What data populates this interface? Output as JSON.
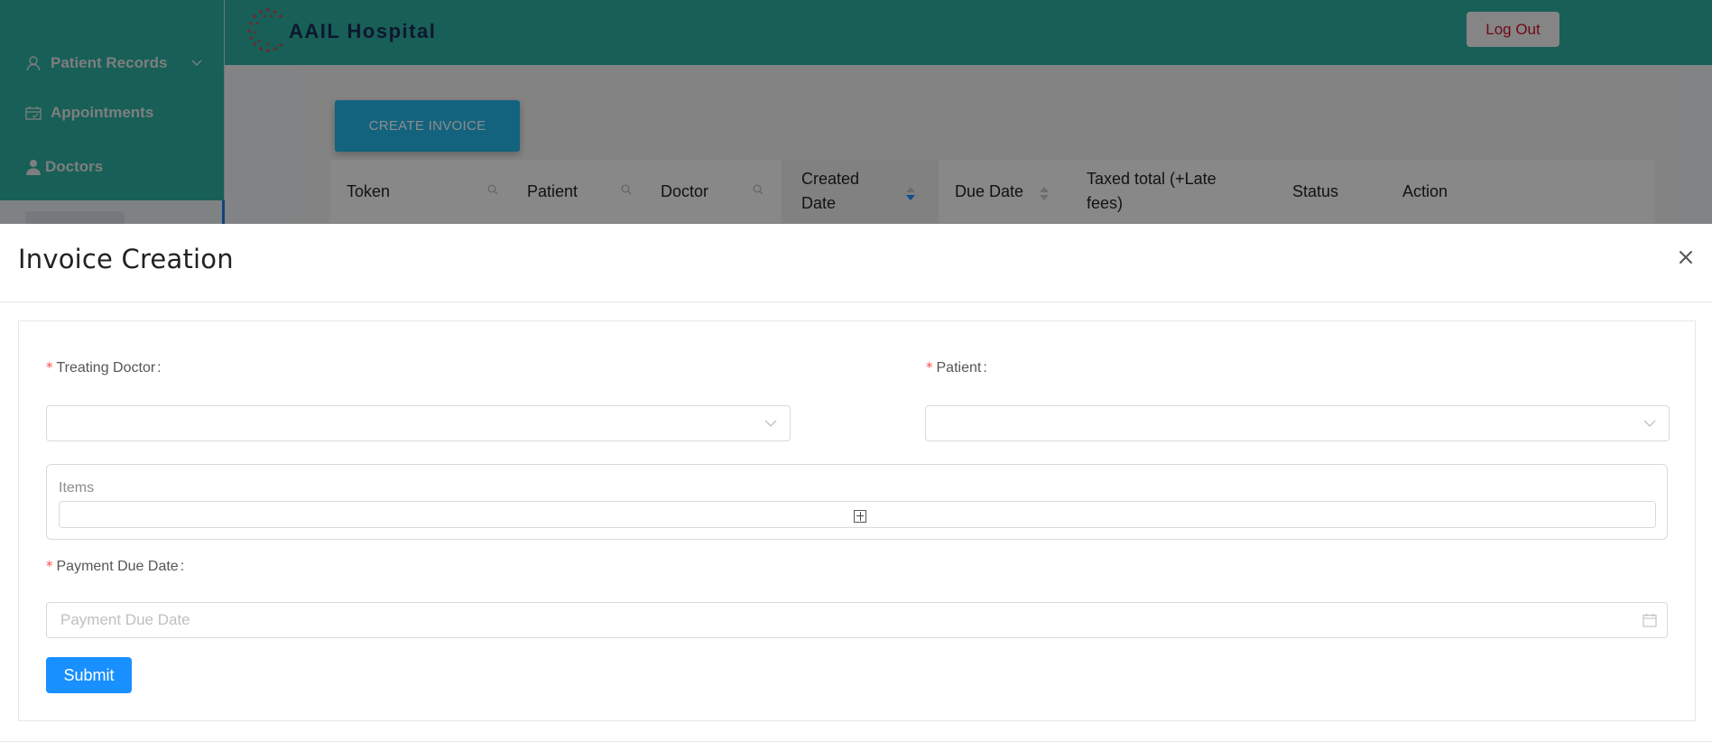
{
  "app": {
    "brand": "AAIL Hospital",
    "logout_label": "Log Out"
  },
  "sidebar": {
    "items": [
      {
        "label": "Patient Records",
        "icon": "user-icon",
        "has_submenu": true
      },
      {
        "label": "Appointments",
        "icon": "calendar-check-icon"
      },
      {
        "label": "Doctors",
        "icon": "doctor-icon"
      }
    ],
    "selected_item_obscured": true
  },
  "main": {
    "create_button_label": "CREATE INVOICE",
    "table": {
      "columns": [
        {
          "label": "Token",
          "filter": "search-icon"
        },
        {
          "label": "Patient",
          "filter": "search-icon"
        },
        {
          "label": "Doctor",
          "filter": "search-icon"
        },
        {
          "label": "Created Date",
          "sortable": true,
          "sort": "descending"
        },
        {
          "label": "Due Date",
          "sortable": true,
          "sort": "none"
        },
        {
          "label": "Taxed total (+Late fees)"
        },
        {
          "label": "Status"
        },
        {
          "label": "Action"
        }
      ]
    }
  },
  "modal": {
    "title": "Invoice Creation",
    "close_icon": "close-icon",
    "form": {
      "treating_doctor": {
        "label": "Treating Doctor",
        "required": true,
        "value": ""
      },
      "patient": {
        "label": "Patient",
        "required": true,
        "value": ""
      },
      "items": {
        "label": "Items",
        "add_icon": "plus-square-icon"
      },
      "payment_due_date": {
        "label": "Payment Due Date",
        "required": true,
        "value": "",
        "placeholder": "Payment Due Date"
      },
      "required_mark": "*",
      "label_suffix": ":",
      "submit_label": "Submit"
    }
  },
  "colors": {
    "primary": "#1890ff",
    "header": "#2aae9f",
    "required": "#ff4d4f",
    "logout_text": "#d0102a"
  }
}
